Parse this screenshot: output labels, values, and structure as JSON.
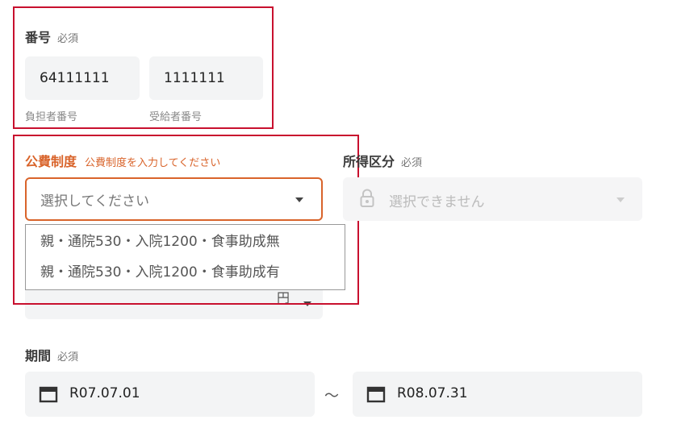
{
  "number_section": {
    "label": "番号",
    "required": "必須",
    "payer_value": "64111111",
    "payer_caption": "負担者番号",
    "recipient_value": "1111111",
    "recipient_caption": "受給者番号"
  },
  "public_expense": {
    "label": "公費制度",
    "error": "公費制度を入力してください",
    "placeholder": "選択してください",
    "options": [
      "親・通院530・入院1200・食事助成無",
      "親・通院530・入院1200・食事助成有"
    ],
    "hidden_fragment": "円"
  },
  "income": {
    "label": "所得区分",
    "required": "必須",
    "placeholder": "選択できません"
  },
  "period": {
    "label": "期間",
    "required": "必須",
    "start": "R07.07.01",
    "separator": "～",
    "end": "R08.07.31"
  },
  "colors": {
    "highlight": "#c8102e",
    "error": "#d9642b"
  }
}
